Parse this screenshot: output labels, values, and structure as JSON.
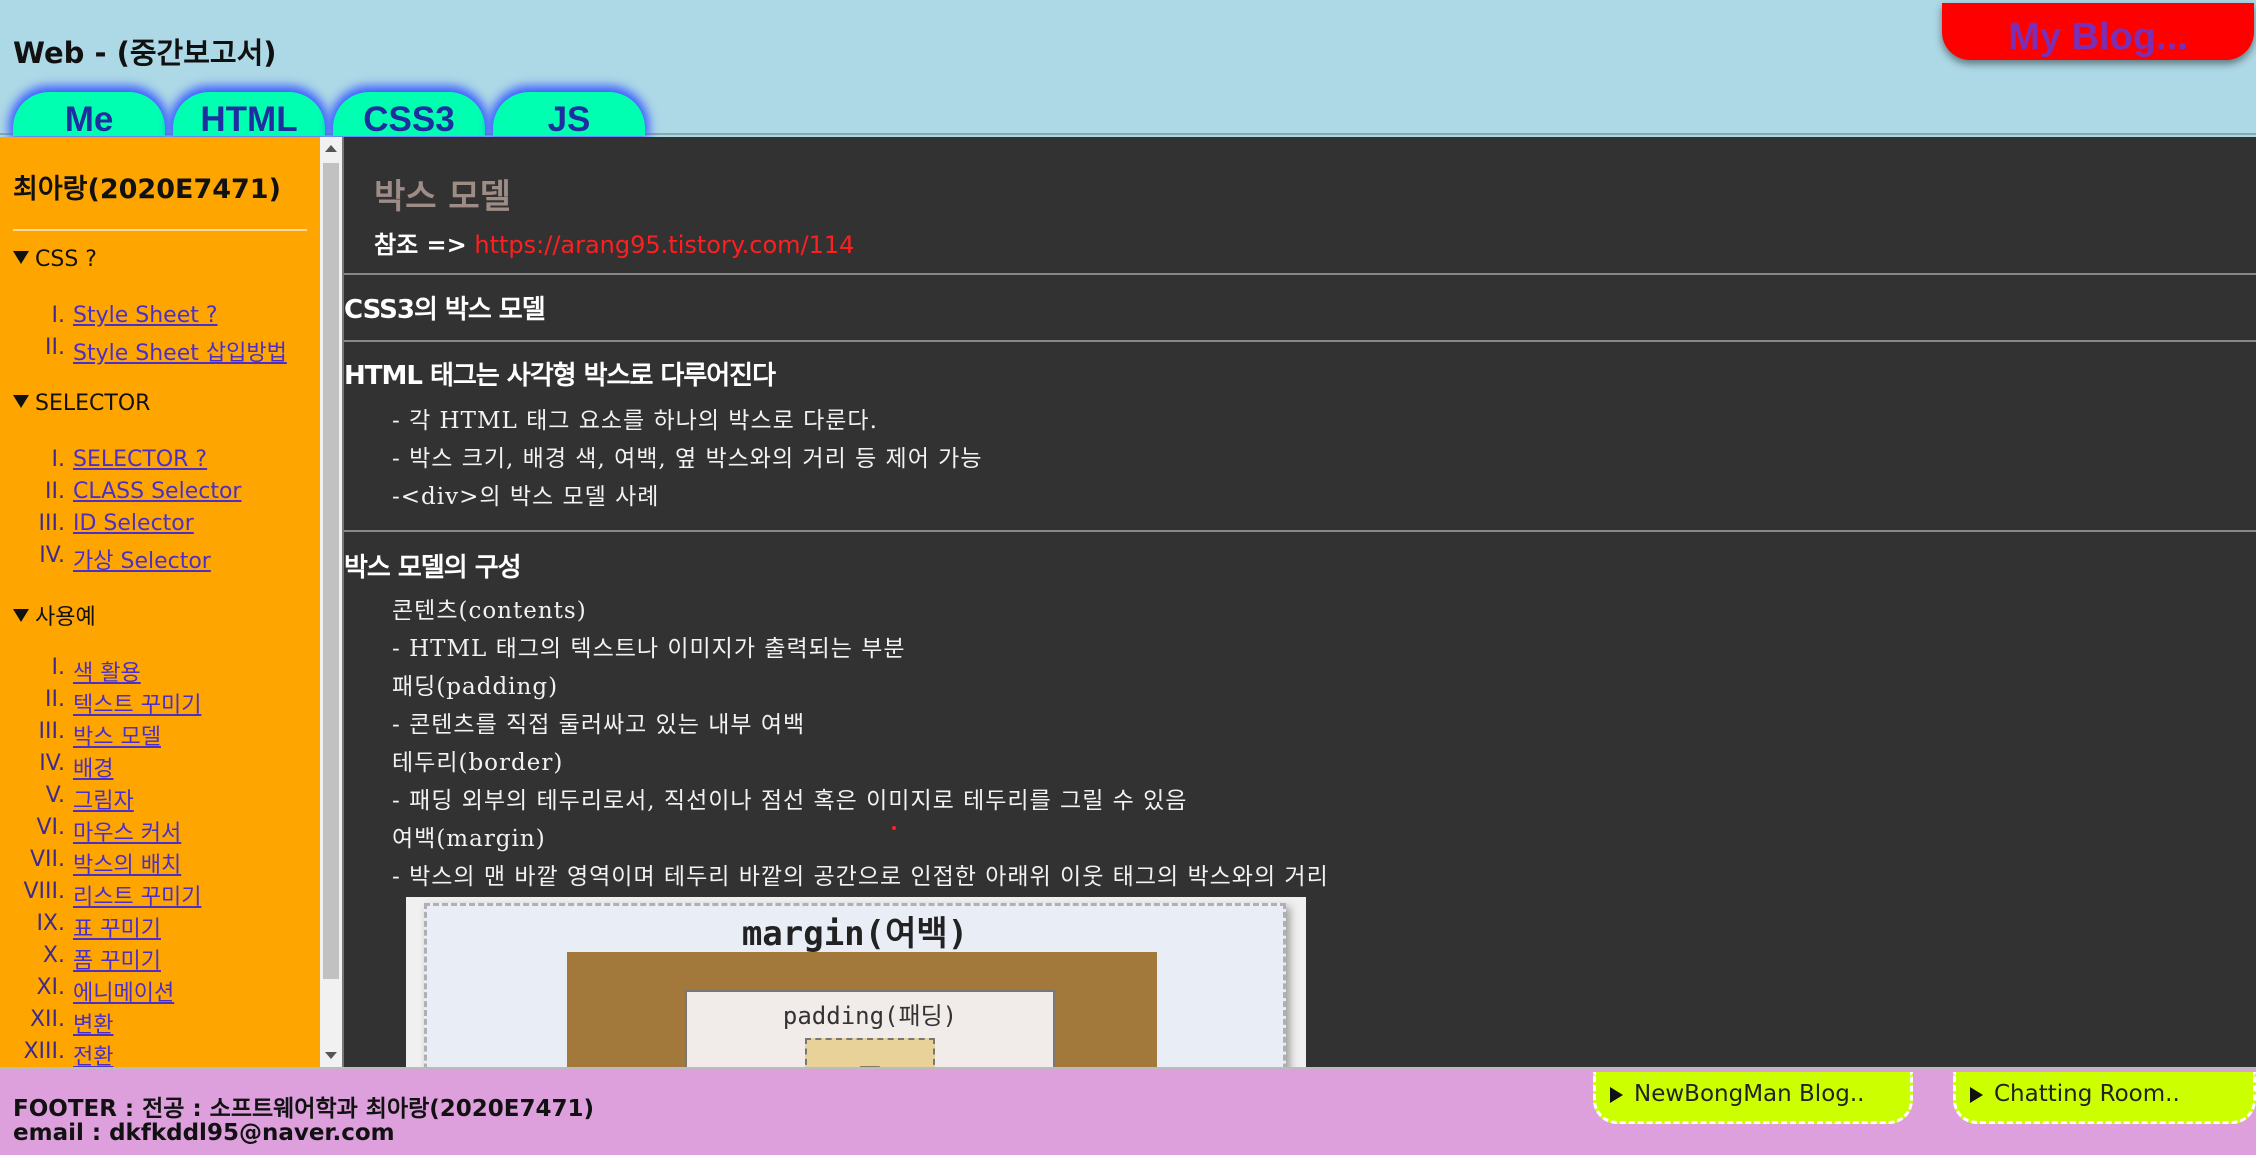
{
  "header": {
    "site_title": "Web - (중간보고서)",
    "blog_button": "My Blog...",
    "tabs": [
      "Me",
      "HTML",
      "CSS3",
      "JS"
    ]
  },
  "sidebar": {
    "student_name": "최아랑(2020E7471)",
    "groups": [
      {
        "title": "CSS ?",
        "items": [
          {
            "num": "I.",
            "label": "Style Sheet ?"
          },
          {
            "num": "II.",
            "label": "Style Sheet 삽입방법"
          }
        ]
      },
      {
        "title": "SELECTOR",
        "items": [
          {
            "num": "I.",
            "label": "SELECTOR ?"
          },
          {
            "num": "II.",
            "label": "CLASS Selector"
          },
          {
            "num": "III.",
            "label": "ID Selector"
          },
          {
            "num": "IV.",
            "label": "가상 Selector"
          }
        ]
      },
      {
        "title": "사용예",
        "items": [
          {
            "num": "I.",
            "label": "색 활용"
          },
          {
            "num": "II.",
            "label": "텍스트 꾸미기"
          },
          {
            "num": "III.",
            "label": "박스 모델"
          },
          {
            "num": "IV.",
            "label": "배경"
          },
          {
            "num": "V.",
            "label": "그림자"
          },
          {
            "num": "VI.",
            "label": "마우스 커서"
          },
          {
            "num": "VII.",
            "label": "박스의 배치"
          },
          {
            "num": "VIII.",
            "label": "리스트 꾸미기"
          },
          {
            "num": "IX.",
            "label": "표 꾸미기"
          },
          {
            "num": "X.",
            "label": "폼 꾸미기"
          },
          {
            "num": "XI.",
            "label": "에니메이션"
          },
          {
            "num": "XII.",
            "label": "변환"
          },
          {
            "num": "XIII.",
            "label": "전환"
          }
        ]
      }
    ]
  },
  "main": {
    "title": "박스 모델",
    "ref_label": "참조 =>",
    "ref_link": "https://arang95.tistory.com/114",
    "section1": "CSS3의 박스 모델",
    "section2": "HTML 태그는 사각형 박스로 다루어진다",
    "section2_lines": [
      "- 각 HTML 태그 요소를 하나의 박스로 다룬다.",
      "- 박스 크기, 배경 색, 여백, 옆 박스와의 거리 등 제어 가능",
      "-<div>의 박스 모델 사례"
    ],
    "section3": "박스 모델의 구성",
    "section3_lines": [
      "콘텐츠(contents)",
      "- HTML 태그의 텍스트나 이미지가 출력되는 부분",
      "패딩(padding)",
      "- 콘텐츠를 직접 둘러싸고 있는 내부 여백",
      "테두리(border)",
      "- 패딩 외부의 테두리로서, 직선이나 점선 혹은 이미지로 테두리를 그릴 수 있음",
      "여백(margin)",
      "- 박스의 맨 바깥 영역이며 테두리 바깥의 공간으로 인접한 아래위 이웃 태그의 박스와의 거리"
    ],
    "figure": {
      "margin_label": "margin(여백)",
      "padding_label": "padding(패딩)",
      "content_label": "콘"
    }
  },
  "footer": {
    "line1": "FOOTER : 전공 : 소프트웨어학과 최아랑(2020E7471)",
    "line2": "email : dkfkddl95@naver.com",
    "buttons": [
      "NewBongMan Blog..",
      "Chatting Room.."
    ]
  },
  "colors": {
    "header_bg": "#add8e6",
    "sidebar_bg": "#ffa500",
    "main_bg": "#333232",
    "footer_bg": "#dda0dd",
    "tab_bg": "#00ffb0",
    "blog_button_bg": "#ff0000",
    "footer_button_bg": "#ccff00",
    "link_color": "#ff1f1f"
  },
  "icons": [
    "disclosure-triangle-icon",
    "play-triangle-icon",
    "scroll-arrow-up-icon",
    "scroll-arrow-down-icon"
  ]
}
